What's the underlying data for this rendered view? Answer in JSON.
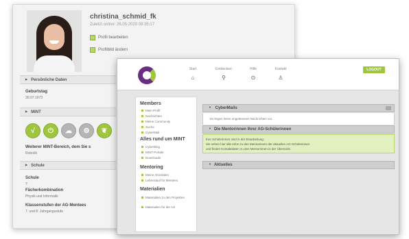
{
  "profile": {
    "username": "christina_schmid_fk",
    "last_online": "Zuletzt online: 26.05.2020 09:35:17",
    "links": [
      "Profil bearbeiten",
      "Profilbild ändern"
    ],
    "sections": [
      {
        "title": "Persönliche Daten"
      },
      {
        "title": "MINT"
      },
      {
        "title": "Schule"
      }
    ],
    "fields": {
      "birthday_label": "Geburtstag",
      "birthday_value": "30.07.1973",
      "mint_more": "Weiterer MINT-Bereich, dem Sie s",
      "mint_more_value": "Robotik",
      "school_label": "Schule",
      "school_value": "Y",
      "subjects_label": "Fächerkombination",
      "subjects_value": "Physik und Informatik",
      "grades_label": "Klassenstufen der AG-Mentees",
      "grades_value": "7. und 8. Jahrgangsstufe"
    },
    "mint_icons": [
      "formula-icon",
      "plug-icon",
      "cloud-icon",
      "gear-icon",
      "leaf-icon"
    ]
  },
  "portal": {
    "nav": [
      {
        "label": "Start",
        "icon": "home-icon"
      },
      {
        "label": "Entdecken",
        "icon": "search-icon"
      },
      {
        "label": "Hilfe",
        "icon": "help-icon"
      },
      {
        "label": "Kontakt",
        "icon": "user-icon"
      }
    ],
    "login_label": "LOGOUT",
    "sidebar": [
      {
        "head": "Members",
        "items": [
          "Mein Profil",
          "Nachrichten",
          "Meine Community",
          "Suche",
          "CyberMail"
        ]
      },
      {
        "head": "Alles rund um MINT",
        "items": [
          "CyberBlog",
          "MINT-Portale",
          "Downloads"
        ]
      },
      {
        "head": "Mentoring",
        "items": [
          "Meine Aktivitäten",
          "Lebenslauf für Mentees"
        ]
      },
      {
        "head": "Materialien",
        "items": [
          "Materialien zu den Projekten",
          "Materialien für die AG"
        ]
      }
    ],
    "panels": [
      {
        "title": "CyberMails",
        "body": "Es liegen keine ungelesenen Nachrichten vor."
      },
      {
        "title": "Die Mentorinnen Ihrer AG-Schülerinnen",
        "body": [
          "Ihre Schülerinnen sind in der Einarbeitung.",
          "Sie sehen hier alle Infos zu den Mentorinnen der aktuellen AG-Schülerinnen",
          "und finden Kontaktdaten zu den Mentorinnen in der Übersicht."
        ]
      },
      {
        "title": "Aktuelles",
        "body": ""
      }
    ]
  },
  "colors": {
    "accent_green": "#9fc63e",
    "brand_purple": "#6a2d86"
  }
}
